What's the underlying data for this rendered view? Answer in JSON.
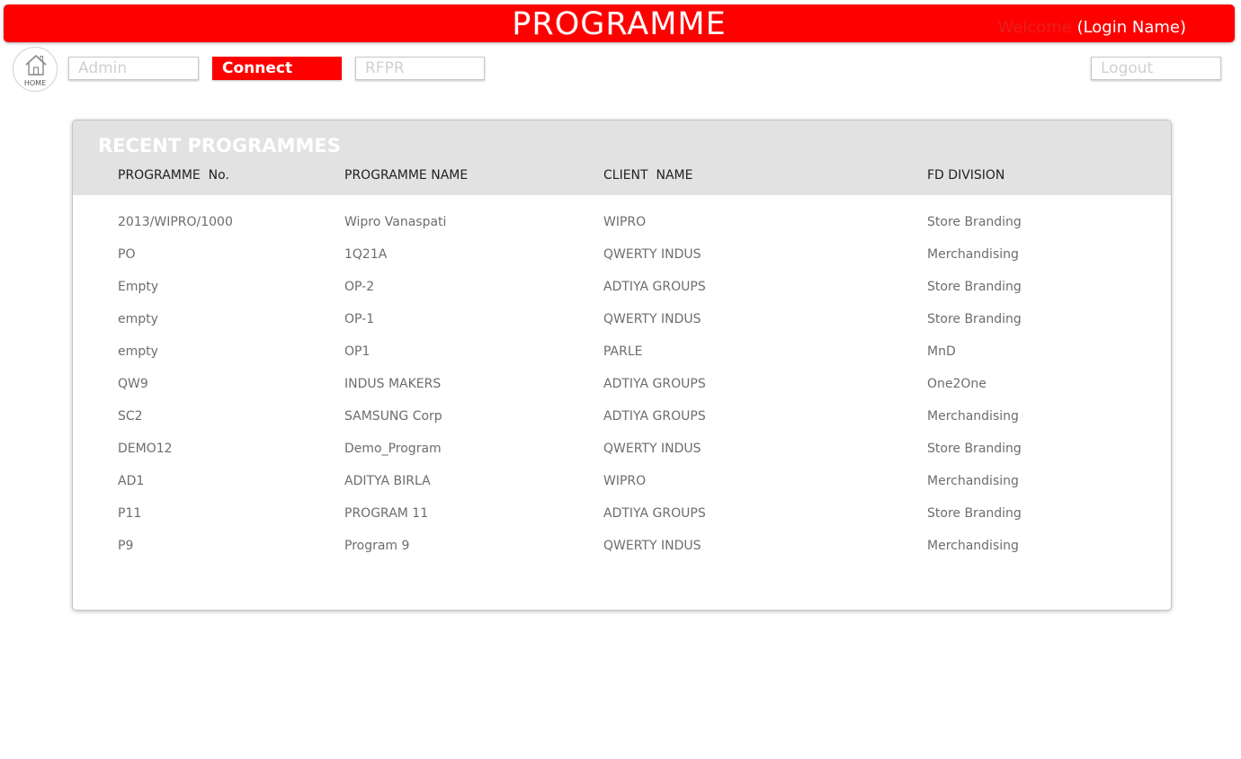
{
  "header": {
    "title": "PROGRAMME",
    "welcome_label": "Welcome",
    "login_name": "(Login Name)"
  },
  "nav": {
    "home_label": "HOME",
    "admin_label": "Admin",
    "connect_label": "Connect",
    "rfpr_label": "RFPR",
    "logout_label": "Logout",
    "active": "Connect"
  },
  "recent": {
    "heading": "RECENT PROGRAMMES",
    "columns": [
      "PROGRAMME  No.",
      "PROGRAMME NAME",
      "CLIENT  NAME",
      "FD DIVISION"
    ],
    "rows": [
      [
        "2013/WIPRO/1000",
        "Wipro Vanaspati",
        "WIPRO",
        "Store Branding"
      ],
      [
        "PO",
        "1Q21A",
        "QWERTY INDUS",
        "Merchandising"
      ],
      [
        "Empty",
        "OP-2",
        "ADTIYA GROUPS",
        "Store Branding"
      ],
      [
        "empty",
        "OP-1",
        "QWERTY INDUS",
        "Store Branding"
      ],
      [
        "empty",
        "OP1",
        "PARLE",
        "MnD"
      ],
      [
        "QW9",
        "INDUS MAKERS",
        "ADTIYA GROUPS",
        "One2One"
      ],
      [
        "SC2",
        "SAMSUNG Corp",
        "ADTIYA GROUPS",
        "Merchandising"
      ],
      [
        "DEMO12",
        "Demo_Program",
        "QWERTY INDUS",
        "Store Branding"
      ],
      [
        "AD1",
        "ADITYA BIRLA",
        "WIPRO",
        "Merchandising"
      ],
      [
        "P11",
        "PROGRAM 11",
        "ADTIYA GROUPS",
        "Store Branding"
      ],
      [
        "P9",
        "Program 9",
        "QWERTY INDUS",
        "Merchandising"
      ]
    ]
  },
  "colors": {
    "brand_red": "#ff0000",
    "header_band": "#e2e2e2",
    "row_text": "#6d6d6d"
  },
  "icons": {
    "home": "home-icon"
  }
}
